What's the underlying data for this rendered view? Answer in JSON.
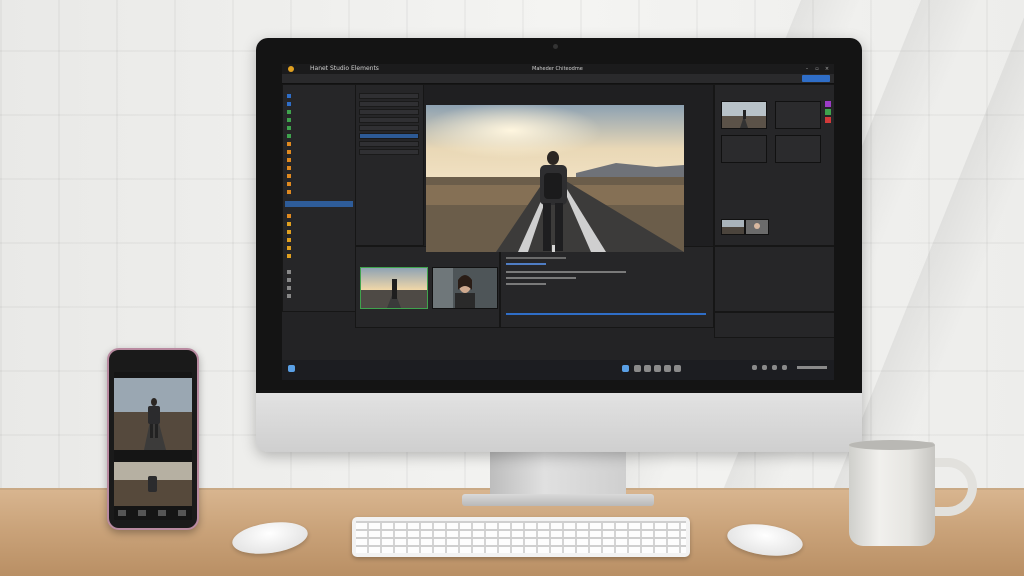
{
  "app": {
    "title": "Hanet Studio Elements",
    "document_title": "Maheder Chiteodme"
  },
  "scene": {
    "objects": [
      "monitor",
      "smartphone",
      "keyboard",
      "mouse",
      "mouse",
      "coffee-mug",
      "desk",
      "wall"
    ]
  },
  "colors": {
    "accent_blue": "#2f6ec8",
    "selection": "#2e5c99",
    "clip_green": "#3fa34d",
    "app_background": "#232325"
  },
  "icons": [
    "logo-icon",
    "minimize-icon",
    "maximize-icon",
    "close-icon",
    "search-icon",
    "windows-start-icon",
    "wifi-icon"
  ]
}
